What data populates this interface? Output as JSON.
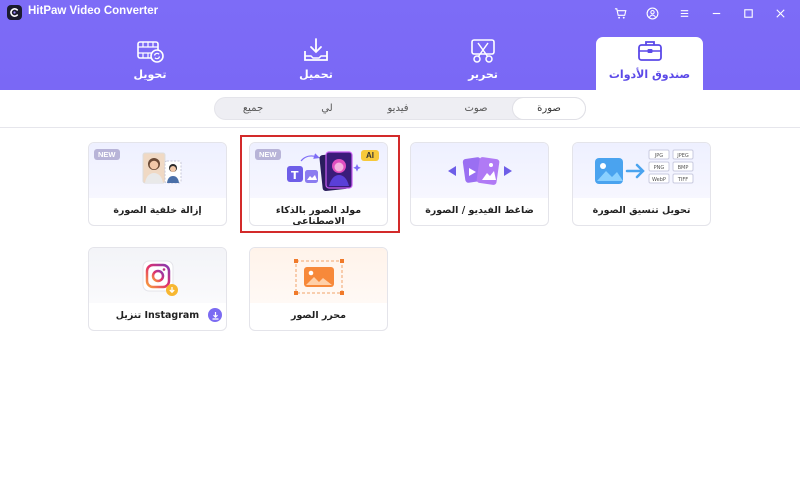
{
  "app": {
    "title": "HitPaw Video Converter",
    "icons": [
      "cart-icon",
      "user-icon",
      "menu-icon",
      "minimize-icon",
      "maximize-icon",
      "close-icon"
    ]
  },
  "main_tabs": [
    {
      "label": "تحويل",
      "icon": "film-convert-icon"
    },
    {
      "label": "تحميل",
      "icon": "download-tray-icon"
    },
    {
      "label": "تحرير",
      "icon": "scissors-edit-icon"
    },
    {
      "label": "صندوق الأدوات",
      "icon": "toolbox-icon",
      "active": true
    }
  ],
  "sub_tabs": [
    {
      "label": "جميع"
    },
    {
      "label": "لي"
    },
    {
      "label": "فيديو"
    },
    {
      "label": "صوت"
    },
    {
      "label": "صورة",
      "active": true
    }
  ],
  "tools": [
    {
      "label": "إزالة خلفية الصورة",
      "badge": "NEW",
      "icon": "background-remove-icon"
    },
    {
      "label": "مولد الصور بالذكاء الاصطناعي",
      "badge": "NEW",
      "badge_ai": "AI",
      "icon": "ai-image-generator-icon"
    },
    {
      "label": "ضاغط الفيديو / الصورة",
      "icon": "compress-icon"
    },
    {
      "label": "تحويل تنسيق الصورة",
      "icon": "image-format-convert-icon",
      "formats": [
        "JPG",
        "JPEG",
        "PNG",
        "BMP",
        "WebP",
        "TIFF"
      ]
    },
    {
      "label": "تنزيل Instagram",
      "icon": "instagram-icon"
    },
    {
      "label": "محرر الصور",
      "icon": "image-editor-icon"
    }
  ],
  "colors": {
    "header": "#7d6cf7",
    "accent": "#5b49e8",
    "highlight": "#d32a2a",
    "ai_badge": "#f7c93b"
  }
}
